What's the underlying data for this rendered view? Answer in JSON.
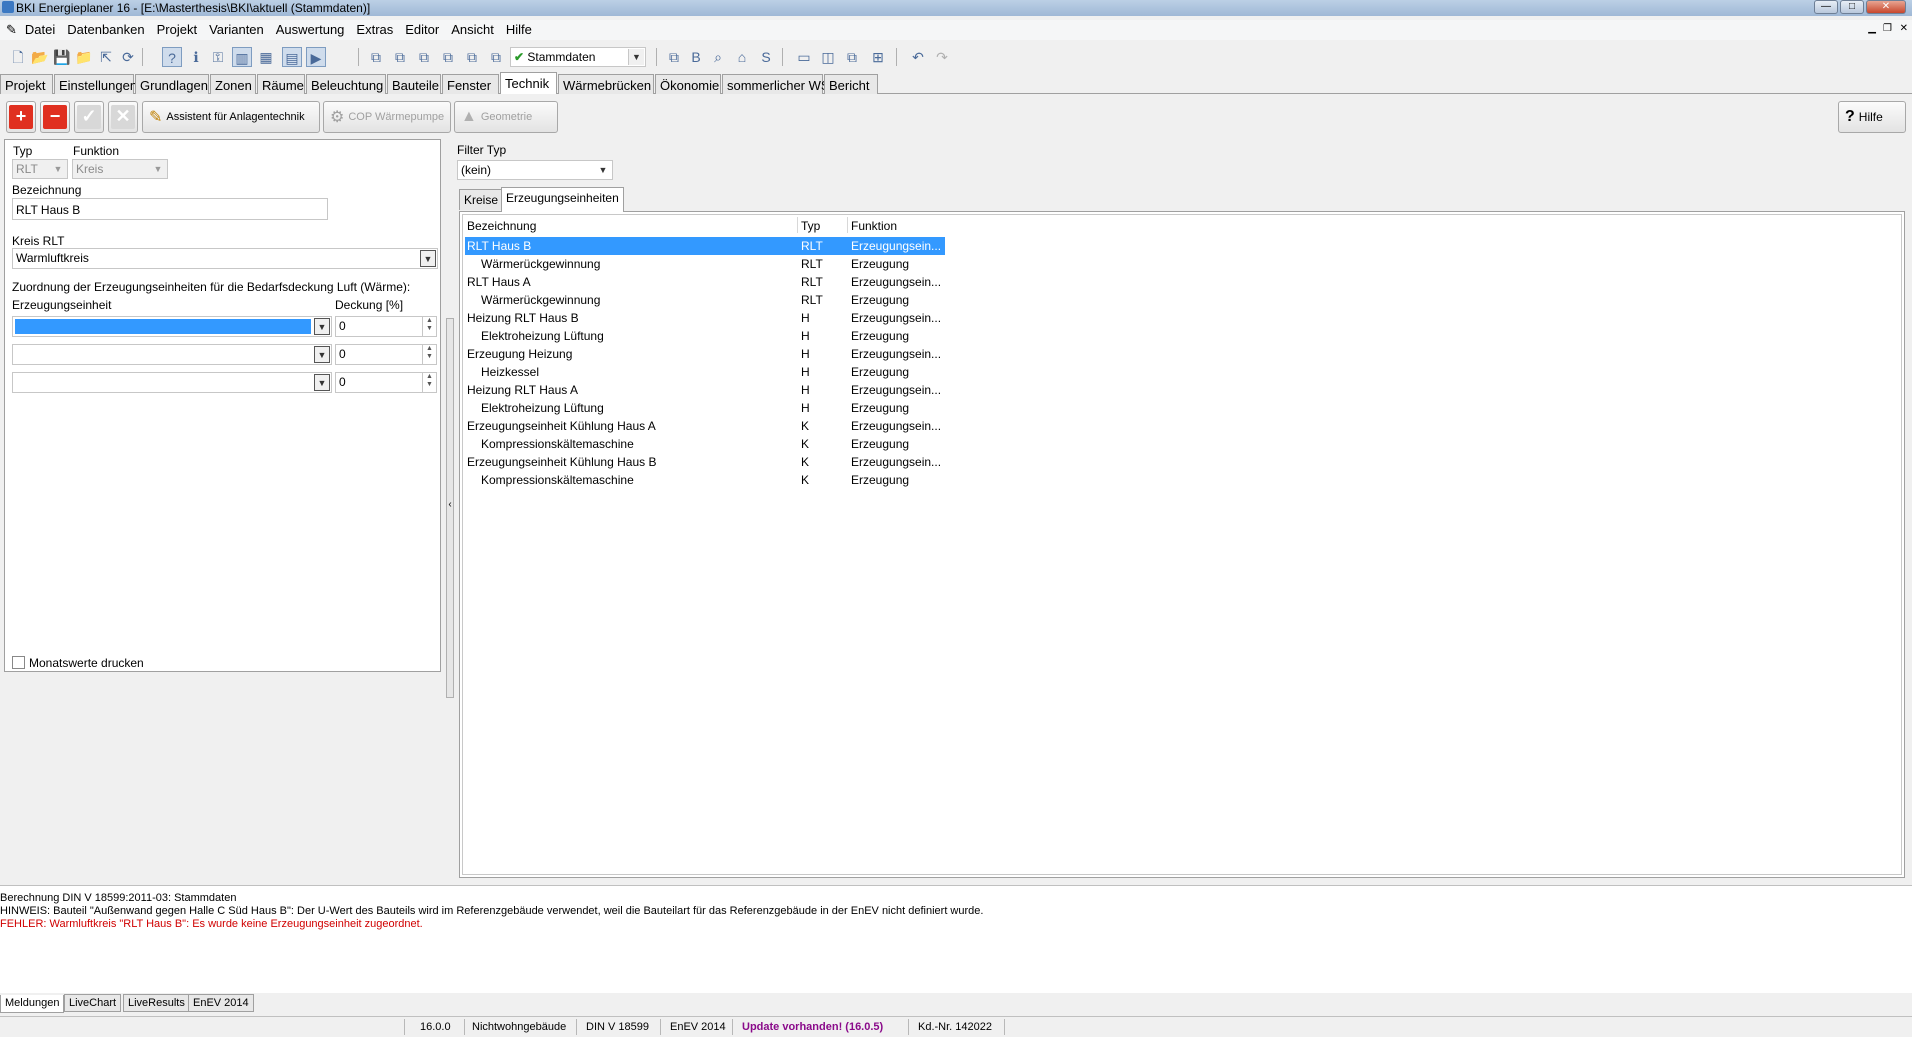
{
  "window": {
    "title": "BKI Energieplaner 16 - [E:\\Masterthesis\\BKI\\aktuell (Stammdaten)]"
  },
  "menu": [
    "Datei",
    "Datenbanken",
    "Projekt",
    "Varianten",
    "Auswertung",
    "Extras",
    "Editor",
    "Ansicht",
    "Hilfe"
  ],
  "toolbar": {
    "stammdaten_value": "Stammdaten"
  },
  "tabs": [
    "Projekt",
    "Einstellungen",
    "Grundlagen",
    "Zonen",
    "Räume",
    "Beleuchtung",
    "Bauteile",
    "Fenster",
    "Technik",
    "Wärmebrücken",
    "Ökonomie",
    "sommerlicher WS",
    "Bericht"
  ],
  "selected_tab": "Technik",
  "actions": {
    "assistant": "Assistent für Anlagentechnik",
    "cop": "COP Wärmepumpe",
    "geometry": "Geometrie",
    "help": "Hilfe"
  },
  "left": {
    "typ_label": "Typ",
    "typ_value": "RLT",
    "funktion_label": "Funktion",
    "funktion_value": "Kreis",
    "bezeichnung_label": "Bezeichnung",
    "bezeichnung_value": "RLT Haus B",
    "kreis_label": "Kreis RLT",
    "kreis_value": "Warmluftkreis",
    "zuordnung_label": "Zuordnung der Erzeugungseinheiten für die Bedarfsdeckung Luft (Wärme):",
    "col_unit": "Erzeugungseinheit",
    "col_deckung": "Deckung [%]",
    "rows": [
      {
        "unit": "",
        "deckung": "0"
      },
      {
        "unit": "",
        "deckung": "0"
      },
      {
        "unit": "",
        "deckung": "0"
      }
    ],
    "monats_label": "Monatswerte drucken"
  },
  "right": {
    "filter_label": "Filter Typ",
    "filter_value": "(kein)",
    "subtabs": [
      "Kreise",
      "Erzeugungseinheiten"
    ],
    "columns": [
      "Bezeichnung",
      "Typ",
      "Funktion"
    ],
    "rows": [
      {
        "name": "RLT Haus B",
        "typ": "RLT",
        "funktion": "Erzeugungsein...",
        "indent": false,
        "selected": true
      },
      {
        "name": "Wärmerückgewinnung",
        "typ": "RLT",
        "funktion": "Erzeugung",
        "indent": true,
        "selected": false
      },
      {
        "name": "RLT Haus A",
        "typ": "RLT",
        "funktion": "Erzeugungsein...",
        "indent": false,
        "selected": false
      },
      {
        "name": "Wärmerückgewinnung",
        "typ": "RLT",
        "funktion": "Erzeugung",
        "indent": true,
        "selected": false
      },
      {
        "name": "Heizung RLT Haus B",
        "typ": "H",
        "funktion": "Erzeugungsein...",
        "indent": false,
        "selected": false
      },
      {
        "name": "Elektroheizung Lüftung",
        "typ": "H",
        "funktion": "Erzeugung",
        "indent": true,
        "selected": false
      },
      {
        "name": "Erzeugung Heizung",
        "typ": "H",
        "funktion": "Erzeugungsein...",
        "indent": false,
        "selected": false
      },
      {
        "name": "Heizkessel",
        "typ": "H",
        "funktion": "Erzeugung",
        "indent": true,
        "selected": false
      },
      {
        "name": "Heizung RLT Haus A",
        "typ": "H",
        "funktion": "Erzeugungsein...",
        "indent": false,
        "selected": false
      },
      {
        "name": "Elektroheizung Lüftung",
        "typ": "H",
        "funktion": "Erzeugung",
        "indent": true,
        "selected": false
      },
      {
        "name": "Erzeugungseinheit Kühlung Haus A",
        "typ": "K",
        "funktion": "Erzeugungsein...",
        "indent": false,
        "selected": false
      },
      {
        "name": "Kompressionskältemaschine",
        "typ": "K",
        "funktion": "Erzeugung",
        "indent": true,
        "selected": false
      },
      {
        "name": "Erzeugungseinheit Kühlung Haus B",
        "typ": "K",
        "funktion": "Erzeugungsein...",
        "indent": false,
        "selected": false
      },
      {
        "name": "Kompressionskältemaschine",
        "typ": "K",
        "funktion": "Erzeugung",
        "indent": true,
        "selected": false
      }
    ]
  },
  "messages": [
    {
      "text": "Berechnung DIN V 18599:2011-03: Stammdaten",
      "color": "#000000"
    },
    {
      "text": "HINWEIS: Bauteil \"Außenwand gegen Halle C Süd  Haus B\": Der U-Wert des Bauteils wird im Referenzgebäude verwendet, weil die Bauteilart für das Referenzgebäude in der EnEV nicht definiert wurde.",
      "color": "#000000"
    },
    {
      "text": "FEHLER: Warmluftkreis \"RLT Haus B\": Es wurde keine Erzeugungseinheit zugeordnet.",
      "color": "#d00000"
    }
  ],
  "bottom_tabs": [
    "Meldungen",
    "LiveChart",
    "LiveResults",
    "EnEV 2014"
  ],
  "status": {
    "version": "16.0.0",
    "building": "Nichtwohngebäude",
    "norm": "DIN V 18599",
    "enev": "EnEV 2014",
    "update": "Update vorhanden! (16.0.5)",
    "kdnr": "Kd.-Nr. 142022"
  }
}
